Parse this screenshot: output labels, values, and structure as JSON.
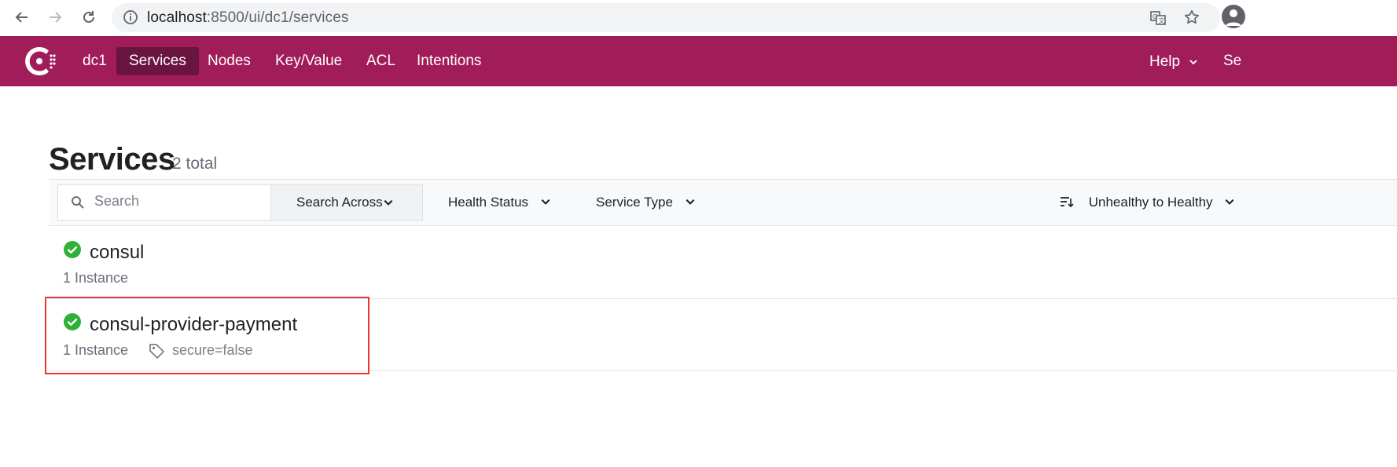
{
  "browser": {
    "url_host": "localhost",
    "url_path": ":8500/ui/dc1/services"
  },
  "header": {
    "datacenter": "dc1",
    "nav": {
      "services": "Services",
      "nodes": "Nodes",
      "kv": "Key/Value",
      "acl": "ACL",
      "intentions": "Intentions"
    },
    "help": "Help",
    "settings": "Se"
  },
  "page": {
    "title": "Services",
    "count": "2 total"
  },
  "filters": {
    "search_placeholder": "Search",
    "search_across": "Search Across",
    "health_status": "Health Status",
    "service_type": "Service Type",
    "sort": "Unhealthy to Healthy"
  },
  "services": [
    {
      "name": "consul",
      "instances": "1 Instance",
      "tag": ""
    },
    {
      "name": "consul-provider-payment",
      "instances": "1 Instance",
      "tag": "secure=false"
    }
  ],
  "colors": {
    "brand": "#a11d5a",
    "brand_active": "#6a1440",
    "healthy": "#2eb039",
    "highlight": "#e53935"
  }
}
